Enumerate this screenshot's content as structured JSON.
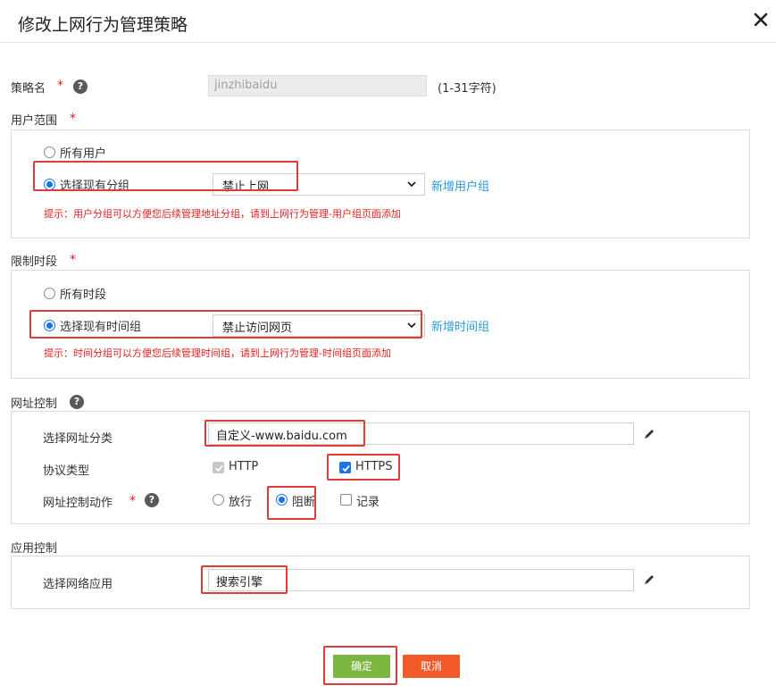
{
  "dialog": {
    "title": "修改上网行为管理策略"
  },
  "policy_name": {
    "label": "策略名",
    "required_mark": "*",
    "value": "jinzhibaidu",
    "hint": "(1-31字符)"
  },
  "user_scope": {
    "label": "用户范围",
    "required_mark": "*",
    "option_all": "所有用户",
    "option_select": "选择现有分组",
    "selected_group": "禁止上网",
    "add_link": "新增用户组",
    "hint": "提示：用户分组可以方便您后续管理地址分组，请到上网行为管理-用户组页面添加"
  },
  "time_limit": {
    "label": "限制时段",
    "required_mark": "*",
    "option_all": "所有时段",
    "option_select": "选择现有时间组",
    "selected_group": "禁止访问网页",
    "add_link": "新增时间组",
    "hint": "提示：时间分组可以方便您后续管理时间组，请到上网行为管理-时间组页面添加"
  },
  "url_control": {
    "label": "网址控制",
    "category_label": "选择网址分类",
    "category_value": "自定义-www.baidu.com",
    "protocol_label": "协议类型",
    "protocol_http": "HTTP",
    "protocol_https": "HTTPS",
    "action_label": "网址控制动作",
    "required_mark": "*",
    "action_allow": "放行",
    "action_block": "阻断",
    "action_log": "记录"
  },
  "app_control": {
    "label": "应用控制",
    "app_label": "选择网络应用",
    "app_value": "搜索引擎"
  },
  "footer": {
    "ok": "确定",
    "cancel": "取消"
  },
  "colors": {
    "accent": "#1a73e8",
    "link": "#2a9cd8",
    "warning": "#e02020",
    "ok": "#7cb640",
    "cancel": "#f35a2a",
    "highlight": "#e03a3a"
  }
}
